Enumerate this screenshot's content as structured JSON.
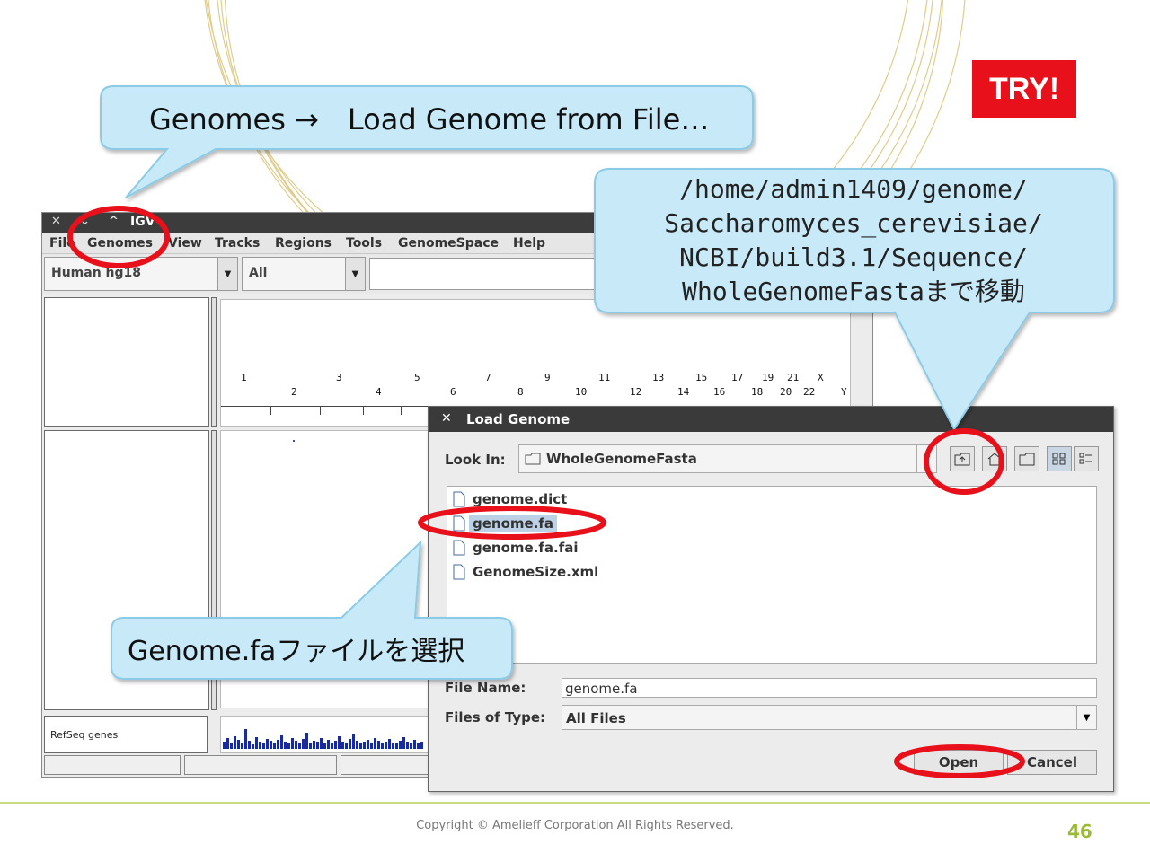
{
  "slide": {
    "try_badge": "TRY!",
    "copyright": "Copyright © Amelieff Corporation All Rights Reserved.",
    "page_number": "46"
  },
  "callouts": {
    "menu_step": "Genomes →　Load Genome from File…",
    "path_lines": [
      "/home/admin1409/genome/",
      "Saccharomyces_cerevisiae/",
      "NCBI/build3.1/Sequence/",
      "WholeGenomeFastaまで移動"
    ],
    "select_file": "Genome.faファイルを選択"
  },
  "igv": {
    "window_title": "IGV",
    "menu": [
      "File",
      "Genomes",
      "View",
      "Tracks",
      "Regions",
      "Tools",
      "GenomeSpace",
      "Help"
    ],
    "genome_select": "Human hg18",
    "chromosome_select": "All",
    "chromosomes_top": [
      "1",
      "3",
      "5",
      "7",
      "9",
      "11",
      "13",
      "15",
      "17",
      "19",
      "21",
      "X"
    ],
    "chromosomes_bottom": [
      "2",
      "4",
      "6",
      "8",
      "10",
      "12",
      "14",
      "16",
      "18",
      "20",
      "22",
      "Y"
    ],
    "refseq_track": "RefSeq genes"
  },
  "dialog": {
    "title": "Load Genome",
    "look_in_label": "Look In:",
    "look_in_value": "WholeGenomeFasta",
    "files": [
      "genome.dict",
      "genome.fa",
      "genome.fa.fai",
      "GenomeSize.xml"
    ],
    "selected_file": "genome.fa",
    "file_name_label": "File Name:",
    "file_name_value": "genome.fa",
    "file_type_label": "Files of Type:",
    "file_type_value": "All Files",
    "open_label": "Open",
    "cancel_label": "Cancel"
  },
  "colors": {
    "callout_fill": "#c8eaf8",
    "highlight_ring": "#e8101a",
    "try_badge": "#e8101a",
    "page_number": "#9cbb34"
  }
}
